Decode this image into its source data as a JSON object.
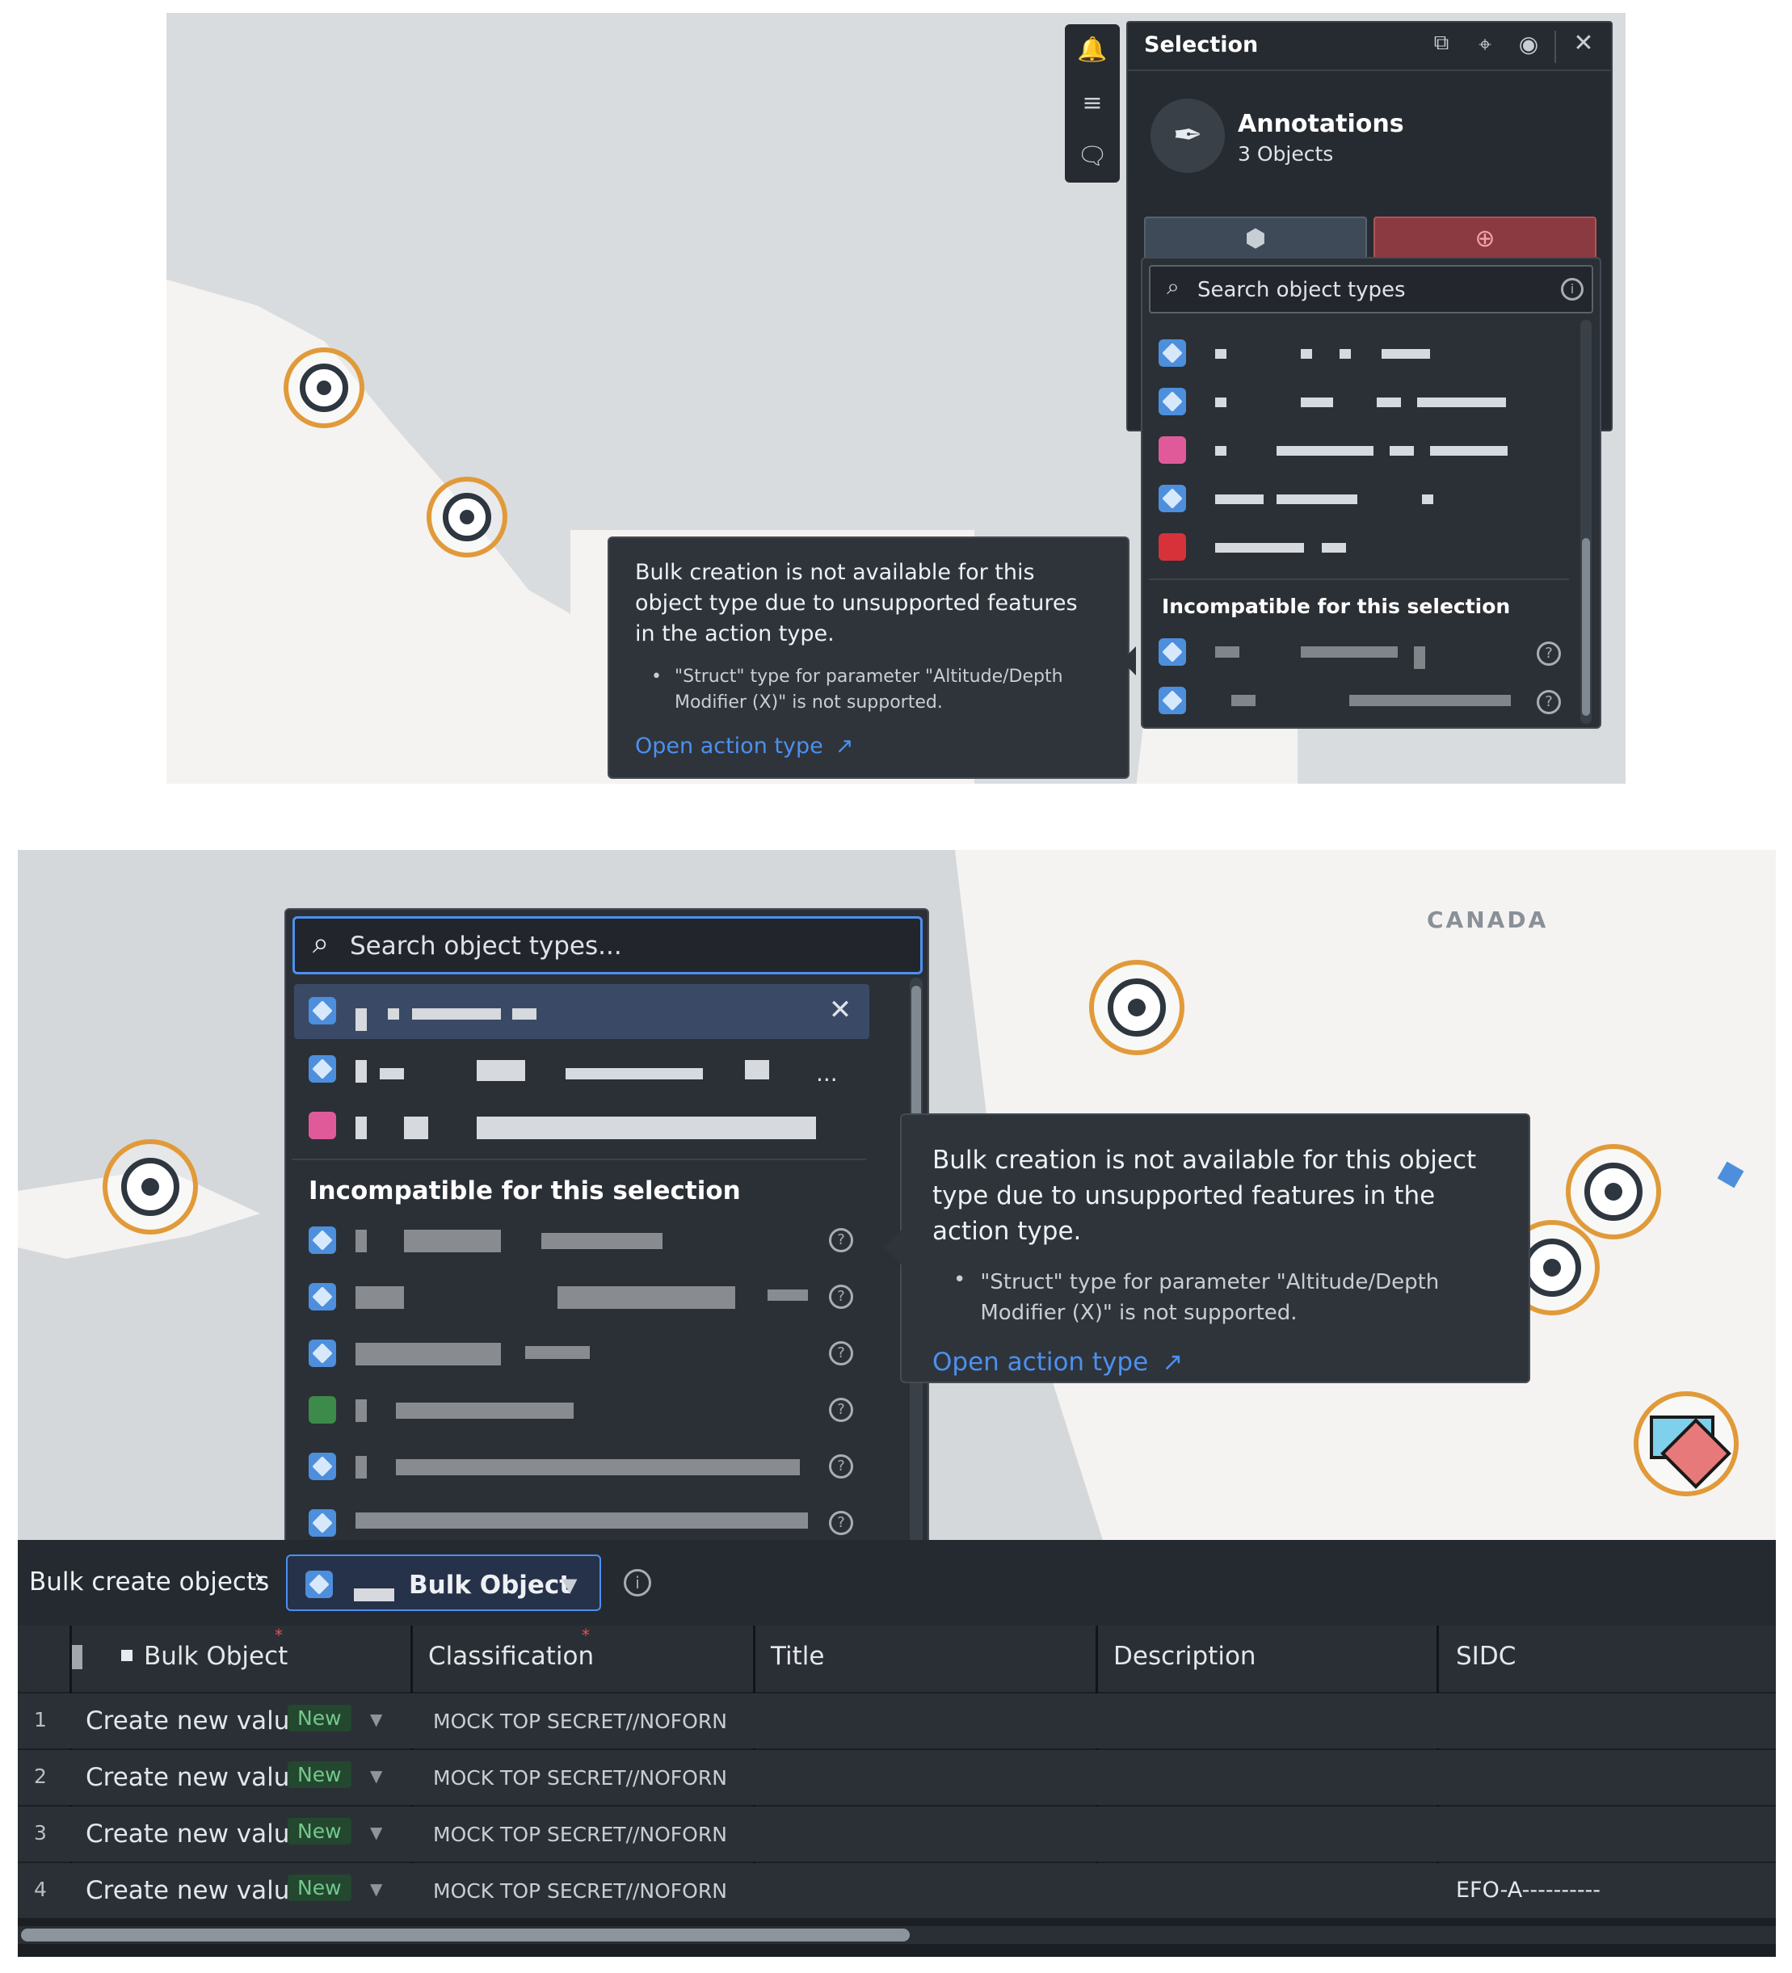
{
  "top": {
    "selection_panel": {
      "header_title": "Selection",
      "name": "Annotations",
      "subtitle": "3 Objects",
      "search_placeholder": "Search object types",
      "incompatible_header": "Incompatible for this selection"
    },
    "tooltip": {
      "message": "Bulk creation is not available for this object type due to unsupported features in the action type.",
      "bullet": "\"Struct\" type for parameter \"Altitude/Depth Modifier (X)\" is not supported.",
      "link": "Open action type"
    }
  },
  "bottom": {
    "map_label": "CANADA",
    "dropdown": {
      "search_placeholder": "Search object types...",
      "incompatible_header": "Incompatible for this selection",
      "ellipsis": "..."
    },
    "tooltip": {
      "message": "Bulk creation is not available for this object type due to unsupported features in the action type.",
      "bullet": "\"Struct\" type for parameter \"Altitude/Depth Modifier (X)\" is not supported.",
      "link": "Open action type"
    },
    "toolbar": {
      "breadcrumb": "Bulk create objects",
      "selected_type": "Bulk Object"
    },
    "table": {
      "columns": [
        "Bulk Object",
        "Classification",
        "Title",
        "Description",
        "SIDC"
      ],
      "rows": [
        {
          "num": "1",
          "value": "Create new value",
          "badge": "New",
          "classification": "MOCK TOP SECRET//NOFORN",
          "title": "",
          "description": "",
          "sidc": ""
        },
        {
          "num": "2",
          "value": "Create new value",
          "badge": "New",
          "classification": "MOCK TOP SECRET//NOFORN",
          "title": "",
          "description": "",
          "sidc": ""
        },
        {
          "num": "3",
          "value": "Create new value",
          "badge": "New",
          "classification": "MOCK TOP SECRET//NOFORN",
          "title": "",
          "description": "",
          "sidc": ""
        },
        {
          "num": "4",
          "value": "Create new value",
          "badge": "New",
          "classification": "MOCK TOP SECRET//NOFORN",
          "title": "",
          "description": "",
          "sidc": "EFO-A----------"
        }
      ]
    }
  },
  "colors": {
    "accent": "#4c90f0",
    "marker": "#e19a3a",
    "danger": "#d7323a",
    "badge_bg": "#24472f",
    "badge_text": "#72c98a"
  }
}
